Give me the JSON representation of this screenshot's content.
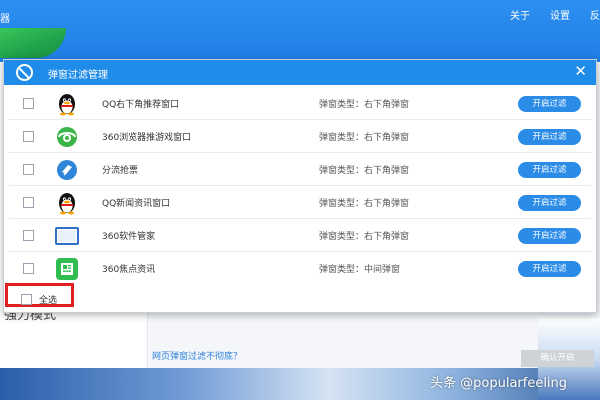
{
  "background": {
    "app_title": "器",
    "menu": [
      "关于",
      "设置",
      "反"
    ],
    "left_label": "强力模式",
    "bottom_link": "网页弹窗过滤不彻底？"
  },
  "dialog": {
    "title": "弹窗过滤管理",
    "close_glyph": "✕",
    "rows": [
      {
        "name": "QQ右下角推荐窗口",
        "type": "弹窗类型：右下角弹窗",
        "button": "开启过滤",
        "icon": "qq-penguin-icon"
      },
      {
        "name": "360浏览器推游戏窗口",
        "type": "弹窗类型：右下角弹窗",
        "button": "开启过滤",
        "icon": "360-browser-icon"
      },
      {
        "name": "分流抢票",
        "type": "弹窗类型：右下角弹窗",
        "button": "开启过滤",
        "icon": "ticket-grab-icon"
      },
      {
        "name": "QQ新闻资讯窗口",
        "type": "弹窗类型：右下角弹窗",
        "button": "开启过滤",
        "icon": "qq-penguin-icon"
      },
      {
        "name": "360软件管家",
        "type": "弹窗类型：右下角弹窗",
        "button": "开启过滤",
        "icon": "360-software-manager-icon"
      },
      {
        "name": "360焦点资讯",
        "type": "弹窗类型：中间弹窗",
        "button": "开启过滤",
        "icon": "360-news-icon"
      }
    ],
    "select_all_label": "全选",
    "confirm_label": "确认开启"
  },
  "watermark": "头条 @popularfeeling",
  "colors": {
    "header_blue": "#1f8ce9",
    "button_blue": "#2b8ce8",
    "highlight_red": "#e02020",
    "disabled_gray": "#cfd3d8"
  }
}
